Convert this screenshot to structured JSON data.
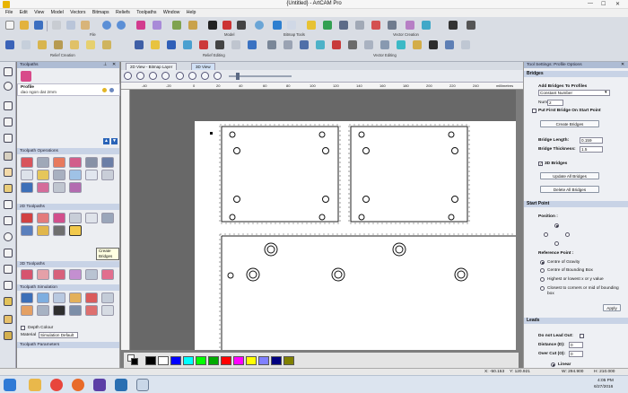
{
  "window": {
    "title": "{Untitled} - ArtCAM Pro"
  },
  "menu": [
    "File",
    "Edit",
    "View",
    "Model",
    "Vectors",
    "Bitmaps",
    "Reliefs",
    "Toolpaths",
    "Window",
    "Help"
  ],
  "toolbar_groups": [
    "File",
    "Model",
    "Bitmap Tools",
    "Vector Creation",
    "Relief Creation",
    "Relief Editing",
    "Vector Editing"
  ],
  "toolpaths_panel": {
    "title": "Toolpaths",
    "profile_name": "Profile",
    "profile_sub": "dao ngon dat 2mm",
    "sections": [
      "Toolpath Operations",
      "2D Toolpaths",
      "3D Toolpaths",
      "Toolpath Simulation",
      "Toolpath Parameters"
    ],
    "tooltip": "Create Bridges",
    "depth_colour_label": "Depth Colour",
    "material_label": "Material",
    "material_value": "Simulation Default"
  },
  "view": {
    "tabs": [
      "2D View - Bitmap Layer",
      "3D View"
    ],
    "ruler_h": [
      "-40",
      "-20",
      "0",
      "20",
      "40",
      "60",
      "80",
      "100",
      "120",
      "140",
      "160",
      "180",
      "200",
      "220",
      "240"
    ],
    "ruler_units": "millimetres"
  },
  "palette": {
    "colors": [
      "#000000",
      "#ffffff",
      "#0000ff",
      "#00ffff",
      "#00ff00",
      "#00aa00",
      "#ff0000",
      "#ff00ff",
      "#ffff00",
      "#8080ff",
      "#000080",
      "#808000"
    ]
  },
  "status": {
    "x": "X: -50.153",
    "y": "Y: 120.921",
    "w": "W: 294.900",
    "h": "H: 210.000"
  },
  "taskbar": {
    "time": "4:05 PM",
    "date": "6/27/2016"
  },
  "tool_settings": {
    "title": "Tool Settings: Profile Options",
    "bridges": {
      "header": "Bridges",
      "add_label": "Add Bridges To Profiles",
      "mode_value": "Constant Number",
      "number_label": "Number",
      "number_value": "2",
      "first_bridge_label": "Put First Bridge On Start Point",
      "create_button": "Create Bridges",
      "length_label": "Bridge Length:",
      "length_value": "0.159",
      "thickness_label": "Bridge Thickness:",
      "thickness_value": "1.5",
      "bridges3d_label": "3D Bridges",
      "update_button": "Update All Bridges",
      "delete_button": "Delete All Bridges"
    },
    "start_point": {
      "header": "Start Point",
      "position_label": "Position :",
      "ref_label": "Reference Point :",
      "options": [
        "Centre of Gravity",
        "Centre of Bounding Box",
        "Highest or lowest x or y value",
        "Closest to corners or mid of bounding box"
      ],
      "apply_button": "Apply"
    },
    "leads": {
      "header": "Leads",
      "no_lead_label": "Do not Lead Out:",
      "distance_label": "Distance (D):",
      "distance_value": "0",
      "overcut_label": "Over Cut (O):",
      "overcut_value": "0",
      "linear_label": "Linear"
    }
  },
  "icons": [
    "search-icon",
    "zoom-in-icon",
    "zoom-out-icon",
    "pin-icon",
    "close-icon"
  ]
}
